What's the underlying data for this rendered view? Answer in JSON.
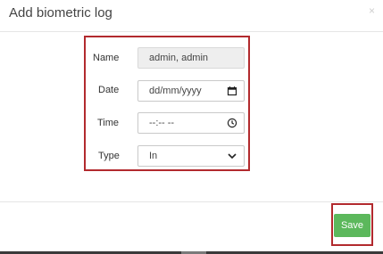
{
  "modal": {
    "title": "Add biometric log",
    "close_glyph": "×"
  },
  "form": {
    "name": {
      "label": "Name",
      "value": "admin, admin"
    },
    "date": {
      "label": "Date",
      "placeholder": "dd/mm/yyyy",
      "icon": "calendar-icon"
    },
    "time": {
      "label": "Time",
      "placeholder": "--:-- --",
      "icon": "clock-icon"
    },
    "type": {
      "label": "Type",
      "selected": "In",
      "icon": "chevron-down-icon"
    }
  },
  "footer": {
    "save_label": "Save"
  },
  "colors": {
    "highlight_border": "#b22a2e",
    "save_button": "#5cb85c"
  }
}
